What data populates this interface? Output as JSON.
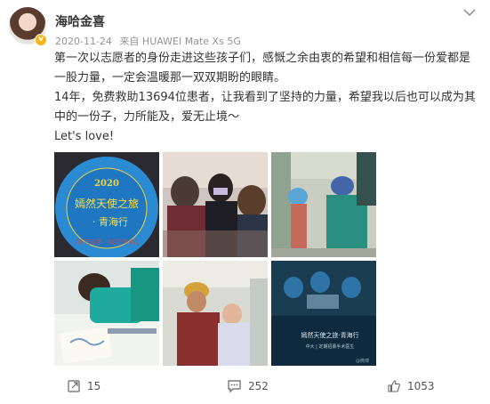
{
  "post": {
    "username": "海哈金喜",
    "verified_badge": "v",
    "date": "2020-11-24",
    "source": "来自 HUAWEI Mate Xs 5G",
    "paragraphs": [
      "第一次以志愿者的身份走进这些孩子们，感慨之余由衷的希望和相信每一份爱都是一股力量，一定会温暖那一双双期盼的眼睛。",
      "14年，免费救助13694位患者，让我看到了坚持的力量，希望我以后也可以成为其中的一份子，力所能及，爱无止境～",
      "Let's love!"
    ]
  },
  "images": {
    "badge_year": "2020",
    "badge_title": "嫣然天使之旅",
    "badge_subtitle": "· 青海行",
    "badge_ring": "我们在这里，我们在你身边",
    "banner_title": "嫣然天使之旅·青海行",
    "banner_subtitle": "中大 | 定期招募手术医生",
    "watermark": "@微博"
  },
  "actions": {
    "repost_count": "15",
    "comment_count": "252",
    "like_count": "1053"
  },
  "colors": {
    "meta_gray": "#939393",
    "verified": "#f6b617"
  },
  "icons": [
    "more-icon",
    "repost-icon",
    "comment-icon",
    "like-icon"
  ]
}
